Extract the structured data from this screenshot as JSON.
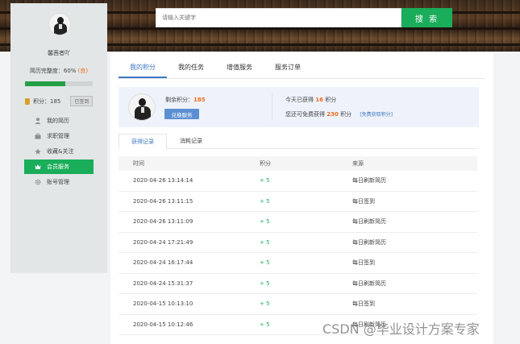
{
  "search": {
    "placeholder": "请输入关键字",
    "button_label": "搜 索"
  },
  "sidebar": {
    "user_name": "馨茜者吖",
    "resume_completion_prefix": "简历完整度：60%",
    "resume_completion_flag": "(良)",
    "resume_completion_value": 0.6,
    "points_label": "积分：185",
    "signed_label": "已签到",
    "menu": [
      {
        "label": "我的简历",
        "icon": "user-icon"
      },
      {
        "label": "求职管理",
        "icon": "briefcase-icon"
      },
      {
        "label": "收藏&关注",
        "icon": "star-icon"
      },
      {
        "label": "会员服务",
        "icon": "crown-icon",
        "active": true
      },
      {
        "label": "账号管理",
        "icon": "gear-icon"
      }
    ]
  },
  "tabs": [
    "我的积分",
    "我的任务",
    "增值服务",
    "服务订单"
  ],
  "score_card": {
    "remain_label": "剩余积分：",
    "remain_value": "185",
    "exchange_button": "兑换服务",
    "today_prefix": "今天已获得",
    "today_value": "16",
    "today_suffix": "积分",
    "free_prefix": "您还可免费获得",
    "free_value": "230",
    "free_suffix": "积分",
    "free_link": "[免费获取积分]"
  },
  "sub_tabs": [
    "获得记录",
    "消耗记录"
  ],
  "table": {
    "headers": [
      "时间",
      "积分",
      "来源"
    ],
    "rows": [
      {
        "time": "2020-04-26 13:14:14",
        "points": "+ 5",
        "source": "每日刷新简历"
      },
      {
        "time": "2020-04-26 13:11:15",
        "points": "+ 5",
        "source": "每日签到"
      },
      {
        "time": "2020-04-26 13:11:09",
        "points": "+ 5",
        "source": "每日刷新简历"
      },
      {
        "time": "2020-04-24 17:21:49",
        "points": "+ 5",
        "source": "每日刷新简历"
      },
      {
        "time": "2020-04-24 16:17:44",
        "points": "+ 5",
        "source": "每日签到"
      },
      {
        "time": "2020-04-24 15:31:37",
        "points": "+ 5",
        "source": "每日刷新简历"
      },
      {
        "time": "2020-04-15 10:13:10",
        "points": "+ 5",
        "source": "每日签到"
      },
      {
        "time": "2020-04-15 10:12:46",
        "points": "+ 5",
        "source": "每日刷新简历"
      }
    ]
  },
  "watermark": "CSDN @毕业设计方案专家",
  "colors": {
    "accent_green": "#1aad5a",
    "accent_blue": "#3f78bf",
    "highlight_orange": "#f06a1a"
  }
}
